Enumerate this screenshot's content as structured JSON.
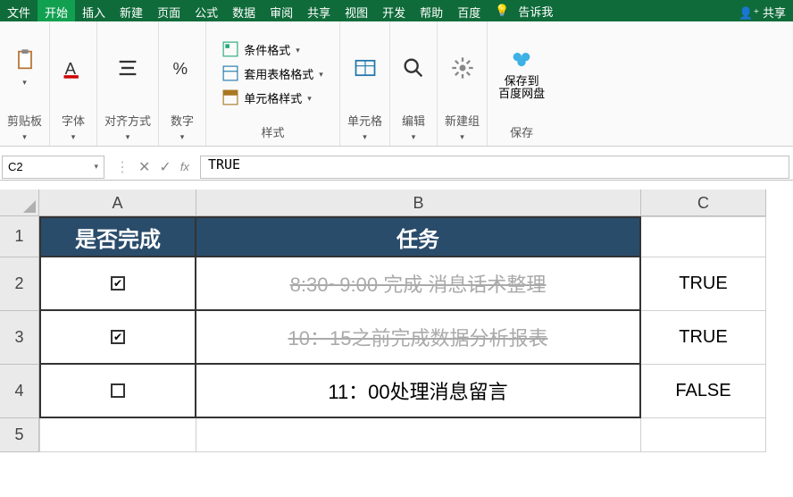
{
  "tabs": {
    "file": "文件",
    "start": "开始",
    "insert": "插入",
    "new": "新建",
    "page": "页面",
    "formula": "公式",
    "data": "数据",
    "review": "审阅",
    "share": "共享",
    "view": "视图",
    "dev": "开发",
    "help": "帮助",
    "baidu": "百度",
    "tellme": "告诉我",
    "share_right": "共享"
  },
  "ribbon": {
    "clipboard_label": "剪贴板",
    "font_label": "字体",
    "align_label": "对齐方式",
    "number_label": "数字",
    "cond_format": "条件格式",
    "format_table": "套用表格格式",
    "cell_style": "单元格样式",
    "styles_label": "样式",
    "cells_label": "单元格",
    "editing_label": "编辑",
    "newgroup_label": "新建组",
    "save_baidu_line1": "保存到",
    "save_baidu_line2": "百度网盘",
    "save_label": "保存"
  },
  "formulaBar": {
    "nameBox": "C2",
    "content": "TRUE"
  },
  "columns": {
    "A": "A",
    "B": "B",
    "C": "C"
  },
  "headers": {
    "colA": "是否完成",
    "colB": "任务"
  },
  "rows": [
    {
      "num": "1"
    },
    {
      "num": "2",
      "done": true,
      "task": "8:30~9:00 完成 消息话术整理",
      "c": "TRUE"
    },
    {
      "num": "3",
      "done": true,
      "task": "10：15之前完成数据分析报表",
      "c": "TRUE"
    },
    {
      "num": "4",
      "done": false,
      "task": "11：00处理消息留言",
      "c": "FALSE"
    },
    {
      "num": "5"
    }
  ]
}
